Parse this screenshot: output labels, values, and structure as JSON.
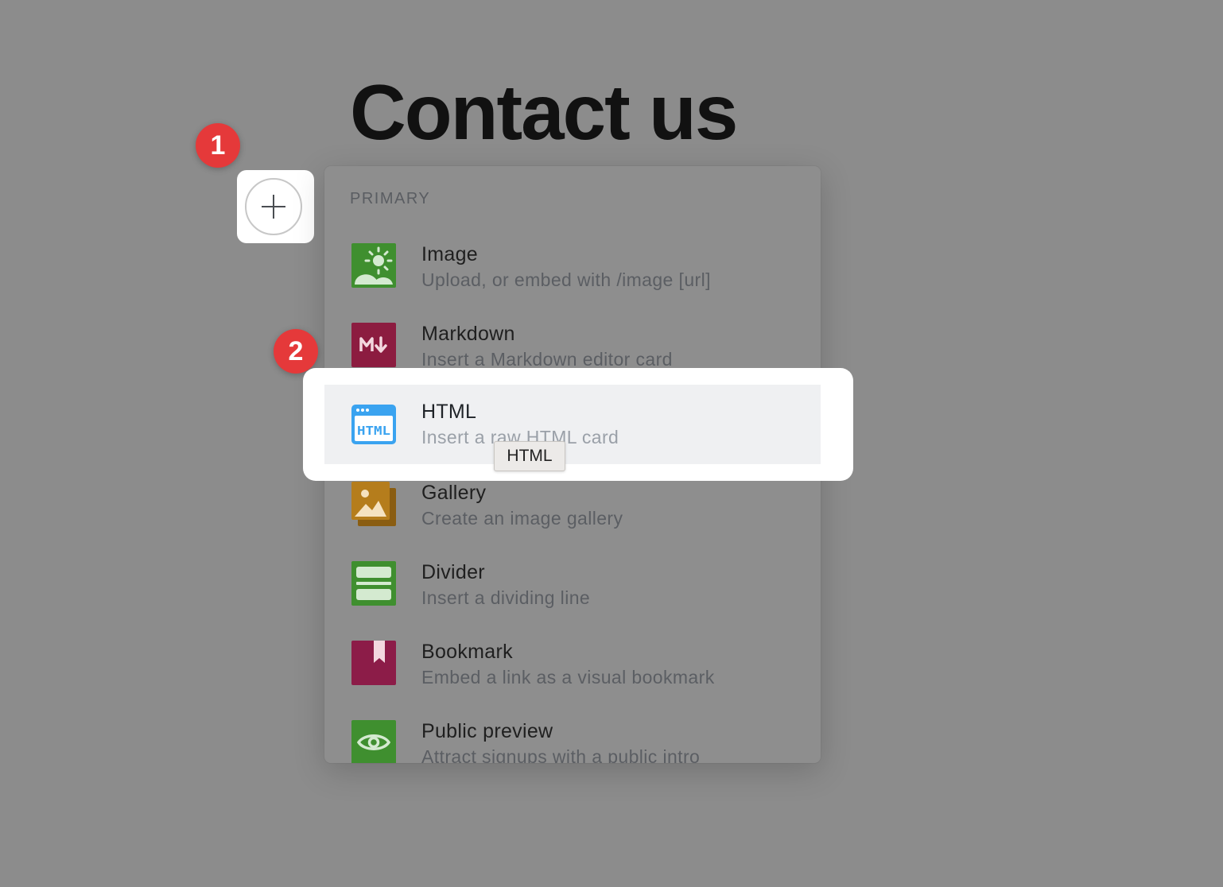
{
  "page": {
    "title": "Contact us"
  },
  "steps": [
    "1",
    "2"
  ],
  "menu": {
    "section_label": "PRIMARY",
    "items": [
      {
        "title": "Image",
        "description": "Upload, or embed with /image [url]",
        "icon": "image-icon",
        "color": "#3f8f2f"
      },
      {
        "title": "Markdown",
        "description": "Insert a Markdown editor card",
        "icon": "markdown-icon",
        "color": "#8c1c40"
      },
      {
        "title": "HTML",
        "description": "Insert a raw HTML card",
        "icon": "html-icon",
        "color": "#3aa3f0"
      },
      {
        "title": "Gallery",
        "description": "Create an image gallery",
        "icon": "gallery-icon",
        "color": "#b57d1c"
      },
      {
        "title": "Divider",
        "description": "Insert a dividing line",
        "icon": "divider-icon",
        "color": "#3f8f2f"
      },
      {
        "title": "Bookmark",
        "description": "Embed a link as a visual bookmark",
        "icon": "bookmark-icon",
        "color": "#8c1c48"
      },
      {
        "title": "Public preview",
        "description": "Attract signups with a public intro",
        "icon": "eye-icon",
        "color": "#3f8f2f"
      }
    ]
  },
  "tooltip": {
    "text": "HTML"
  }
}
